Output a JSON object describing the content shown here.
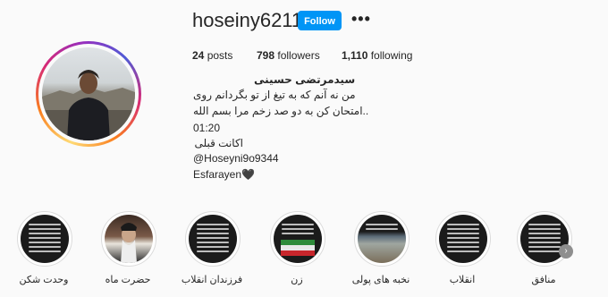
{
  "profile": {
    "username": "hoseiny6211",
    "follow_label": "Follow",
    "more_icon": "more-options-icon",
    "posts_count": "24",
    "posts_label": "posts",
    "followers_count": "798",
    "followers_label": "followers",
    "following_count": "1,110",
    "following_label": "following",
    "display_name": "سیدمرتضی حسینی",
    "bio_lines": [
      "من نه آنم که به تیغ از تو بگردانم روی",
      "..امتحان کن به دو صد زخم مرا بسم الله",
      "01:20",
      "اکانت قبلی",
      "@Hoseyni9o9344",
      "Esfarayen🖤"
    ]
  },
  "highlights": [
    {
      "label": "وحدت شکن"
    },
    {
      "label": "حضرت ماه"
    },
    {
      "label": "فرزندان انقلاب"
    },
    {
      "label": "زن"
    },
    {
      "label": "نخبه های پولی"
    },
    {
      "label": "انقلاب"
    },
    {
      "label": "منافق"
    }
  ],
  "colors": {
    "accent": "#0095f6",
    "text": "#262626",
    "background": "#fafafa"
  }
}
